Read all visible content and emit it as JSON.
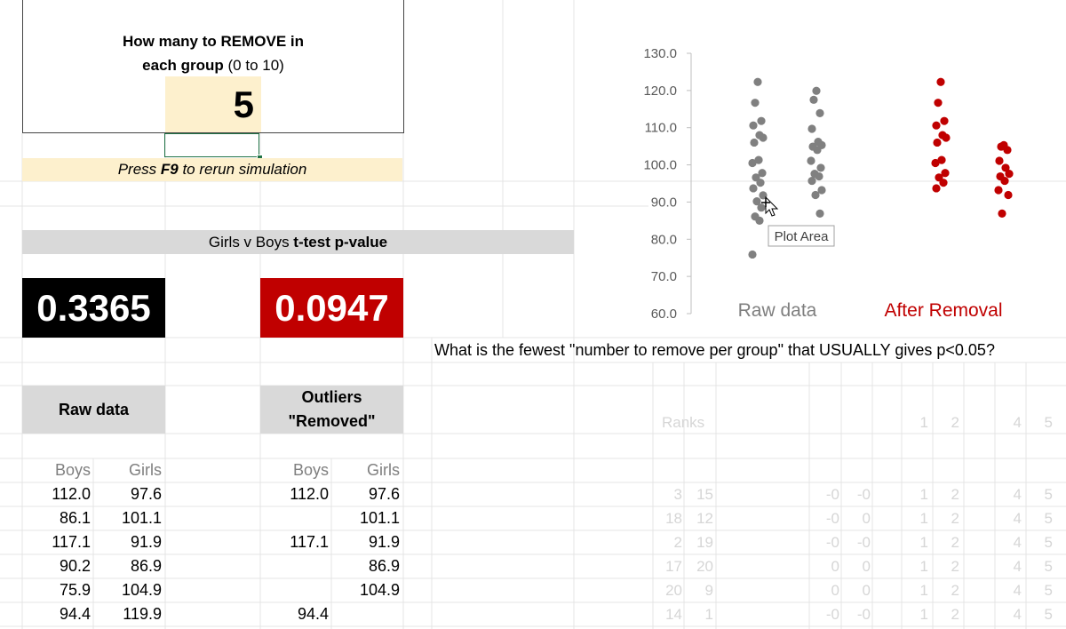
{
  "question_box": {
    "line1": "How many to REMOVE in",
    "line2_bold": "each group",
    "line2_rest": " (0 to 10)",
    "value": "5"
  },
  "hint": {
    "prefix": "Press ",
    "key": "F9",
    "suffix": " to rerun simulation"
  },
  "ttest": {
    "header_prefix": "Girls v Boys ",
    "header_bold": "t-test p-value",
    "raw_p": "0.3365",
    "removed_p": "0.0947"
  },
  "question_text": "What is the fewest \"number to remove per group\" that USUALLY gives p<0.05?",
  "tables": {
    "raw_header": "Raw data",
    "removed_header_l1": "Outliers",
    "removed_header_l2": "\"Removed\"",
    "col_boys": "Boys",
    "col_girls": "Girls",
    "raw_rows": [
      [
        "112.0",
        "97.6"
      ],
      [
        "86.1",
        "101.1"
      ],
      [
        "117.1",
        "91.9"
      ],
      [
        "90.2",
        "86.9"
      ],
      [
        "75.9",
        "104.9"
      ],
      [
        "94.4",
        "119.9"
      ]
    ],
    "removed_rows": [
      [
        "112.0",
        "97.6"
      ],
      [
        "",
        "101.1"
      ],
      [
        "117.1",
        "91.9"
      ],
      [
        "",
        "86.9"
      ],
      [
        "",
        "104.9"
      ],
      [
        "94.4",
        ""
      ]
    ]
  },
  "ranks": {
    "label": "Ranks",
    "header_nums": [
      "1",
      "2",
      "4",
      "5"
    ],
    "rows": [
      [
        "3",
        "15",
        "-0",
        "-0",
        "1",
        "2",
        "4",
        "5"
      ],
      [
        "18",
        "12",
        "-0",
        "0",
        "1",
        "2",
        "4",
        "5"
      ],
      [
        "2",
        "19",
        "-0",
        "-0",
        "1",
        "2",
        "4",
        "5"
      ],
      [
        "17",
        "20",
        "0",
        "0",
        "1",
        "2",
        "4",
        "5"
      ],
      [
        "20",
        "9",
        "0",
        "0",
        "1",
        "2",
        "4",
        "5"
      ],
      [
        "14",
        "1",
        "-0",
        "-0",
        "1",
        "2",
        "4",
        "5"
      ]
    ]
  },
  "chart_data": {
    "type": "scatter",
    "y_ticks": [
      "130.0",
      "120.0",
      "110.0",
      "100.0",
      "90.0",
      "80.0",
      "70.0",
      "60.0"
    ],
    "ylim": [
      60,
      130
    ],
    "categories": [
      "Raw data",
      "After Removal"
    ],
    "colors": {
      "raw": "#808080",
      "removed": "#c00000",
      "removed_label": "#c00000"
    },
    "series": [
      {
        "name": "Raw data",
        "group": "Boys",
        "color": "#808080",
        "values": [
          122.3,
          116.7,
          111.8,
          110.6,
          108.0,
          107.3,
          106.0,
          101.3,
          100.5,
          97.8,
          96.6,
          95.2,
          93.7,
          91.8,
          90.2,
          88.5,
          86.1,
          85.0,
          75.9
        ]
      },
      {
        "name": "Raw data",
        "group": "Girls",
        "color": "#808080",
        "values": [
          119.9,
          117.5,
          113.9,
          109.7,
          106.2,
          105.3,
          104.9,
          104.0,
          101.1,
          99.2,
          97.6,
          96.9,
          95.7,
          93.2,
          91.9,
          86.9
        ]
      },
      {
        "name": "After Removal",
        "group": "Boys",
        "color": "#c00000",
        "values": [
          122.3,
          116.7,
          111.8,
          110.6,
          108.0,
          107.3,
          106.0,
          101.3,
          100.5,
          97.8,
          96.6,
          95.2,
          93.7
        ]
      },
      {
        "name": "After Removal",
        "group": "Girls",
        "color": "#c00000",
        "values": [
          105.3,
          104.9,
          104.0,
          101.1,
          99.2,
          97.6,
          96.9,
          95.7,
          93.2,
          91.9,
          86.9
        ]
      }
    ],
    "tooltip": "Plot Area"
  }
}
